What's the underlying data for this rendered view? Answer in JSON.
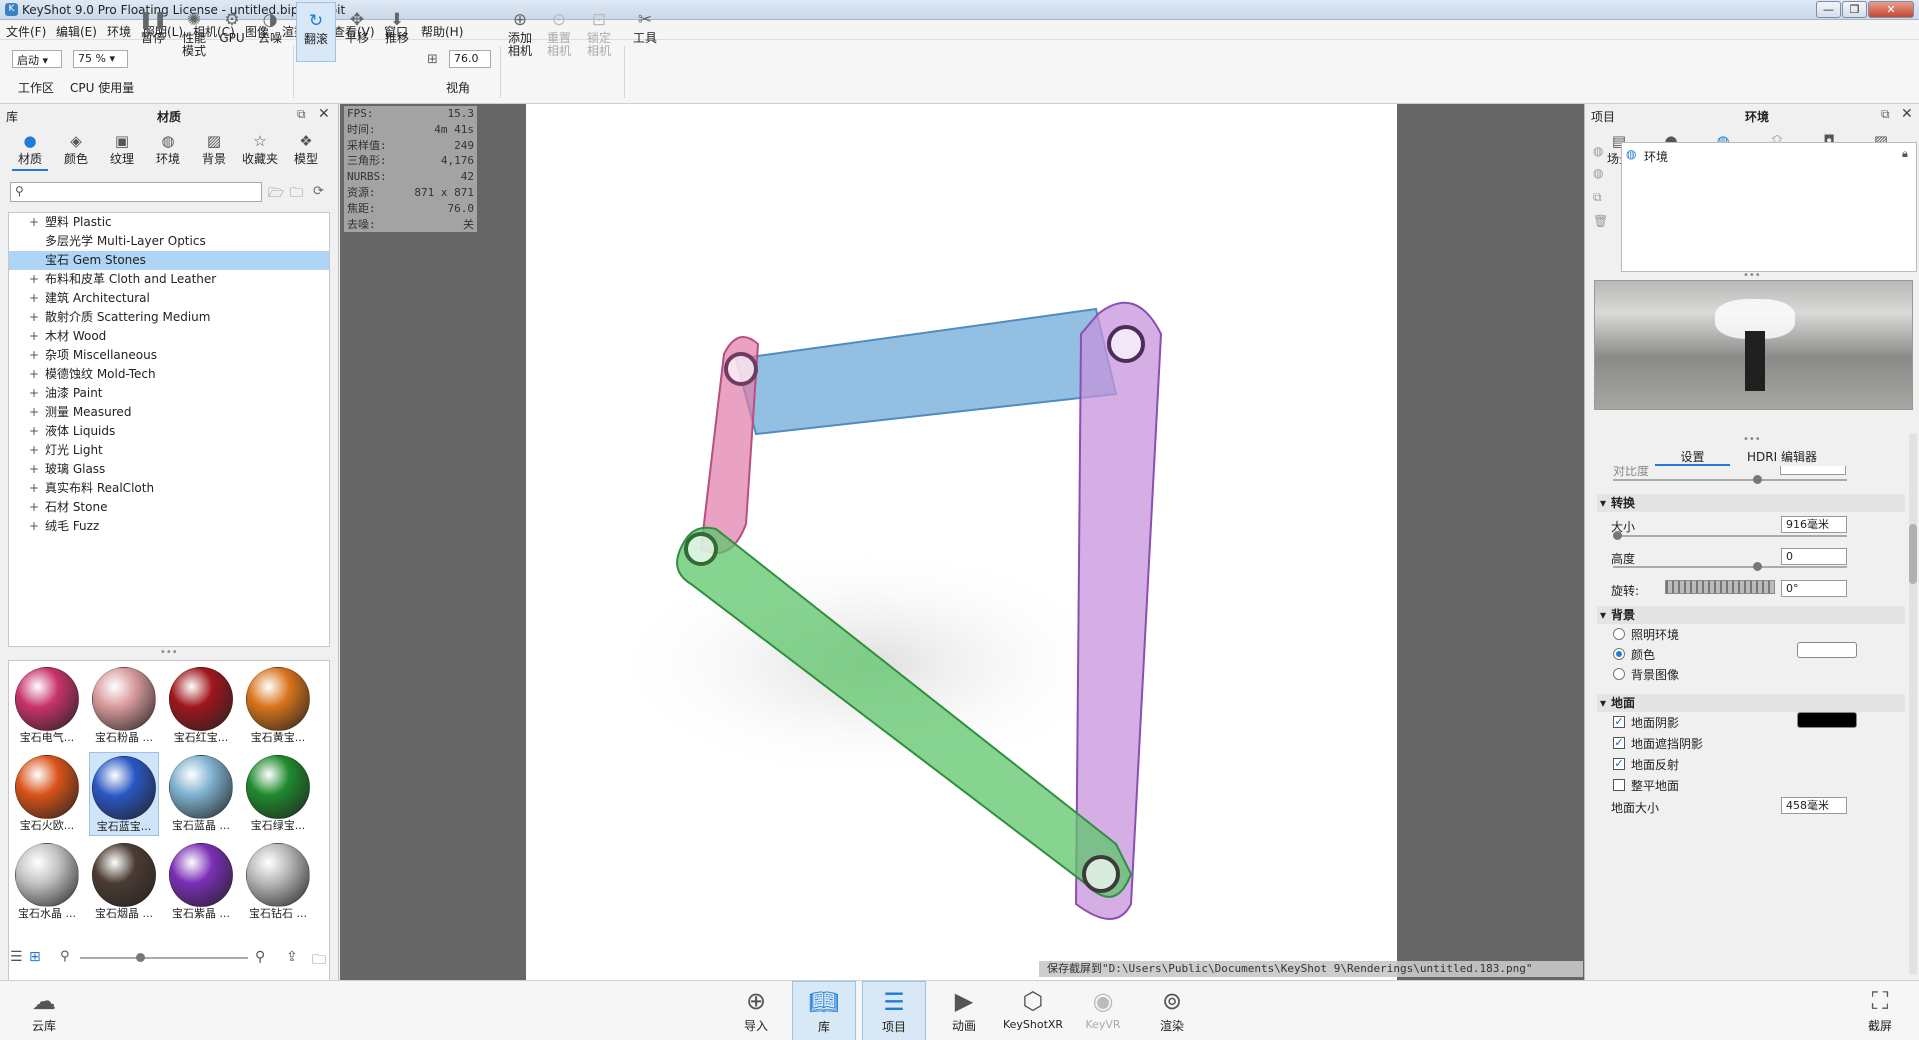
{
  "window": {
    "title": "KeyShot 9.0 Pro Floating License  - untitled.bip  - 64 bit",
    "icon": "keyshot-app-icon"
  },
  "menu": [
    "文件(F)",
    "编辑(E)",
    "环境",
    "照明(L)",
    "相机(C)",
    "图像",
    "渲染(R)",
    "查看(V)",
    "窗口",
    "帮助(H)"
  ],
  "toolbar": {
    "workspace_value": "启动",
    "workspace_label": "工作区",
    "cpu_value": "75 %",
    "cpu_label": "CPU 使用量",
    "pause_label": "暂停",
    "perf_label": "性能\n模式",
    "gpu_label": "GPU",
    "denoise_label": "去噪",
    "tumble_label": "翻滚",
    "pan_label": "平移",
    "dolly_label": "推移",
    "fov_value": "76.0",
    "fov_label": "视角",
    "add_camera_label": "添加\n相机",
    "reset_camera_label": "重置\n相机",
    "lock_camera_label": "锁定\n相机",
    "tools_label": "工具"
  },
  "library": {
    "header_left": "库",
    "title": "材质",
    "tabs": [
      "材质",
      "颜色",
      "纹理",
      "环境",
      "背景",
      "收藏夹",
      "模型"
    ],
    "tree": [
      {
        "label": "塑料 Plastic",
        "expand": true,
        "selected": false
      },
      {
        "label": "多层光学 Multi-Layer Optics",
        "expand": false,
        "selected": false
      },
      {
        "label": "宝石 Gem Stones",
        "expand": false,
        "selected": true
      },
      {
        "label": "布料和皮革 Cloth and Leather",
        "expand": true,
        "selected": false
      },
      {
        "label": "建筑 Architectural",
        "expand": true,
        "selected": false
      },
      {
        "label": "散射介质 Scattering Medium",
        "expand": true,
        "selected": false
      },
      {
        "label": "木材 Wood",
        "expand": true,
        "selected": false
      },
      {
        "label": "杂项 Miscellaneous",
        "expand": true,
        "selected": false
      },
      {
        "label": "模德蚀纹 Mold-Tech",
        "expand": true,
        "selected": false
      },
      {
        "label": "油漆 Paint",
        "expand": true,
        "selected": false
      },
      {
        "label": "测量 Measured",
        "expand": true,
        "selected": false
      },
      {
        "label": "液体 Liquids",
        "expand": true,
        "selected": false
      },
      {
        "label": "灯光 Light",
        "expand": true,
        "selected": false
      },
      {
        "label": "玻璃 Glass",
        "expand": true,
        "selected": false
      },
      {
        "label": "真实布料 RealCloth",
        "expand": true,
        "selected": false
      },
      {
        "label": "石材 Stone",
        "expand": true,
        "selected": false
      },
      {
        "label": "绒毛 Fuzz",
        "expand": true,
        "selected": false
      }
    ],
    "materials": [
      {
        "label": "宝石电气...",
        "color": "#c8336b",
        "selected": false
      },
      {
        "label": "宝石粉晶 ...",
        "color": "#d89a9c",
        "selected": false
      },
      {
        "label": "宝石红宝...",
        "color": "#a0161c",
        "selected": false
      },
      {
        "label": "宝石黄宝...",
        "color": "#d9741c",
        "selected": false
      },
      {
        "label": "宝石火欧...",
        "color": "#d9531a",
        "selected": false
      },
      {
        "label": "宝石蓝宝...",
        "color": "#2a57c4",
        "selected": true
      },
      {
        "label": "宝石蓝晶 ...",
        "color": "#7fb1cf",
        "selected": false
      },
      {
        "label": "宝石绿宝...",
        "color": "#1f8a2e",
        "selected": false
      },
      {
        "label": "宝石水晶 ...",
        "color": "#c4c4c4",
        "selected": false
      },
      {
        "label": "宝石烟晶 ...",
        "color": "#4b3c33",
        "selected": false
      },
      {
        "label": "宝石紫晶 ...",
        "color": "#7a2fb6",
        "selected": false
      },
      {
        "label": "宝石钻石 ...",
        "color": "#b8b8b8",
        "selected": false
      }
    ]
  },
  "stats": [
    {
      "k": "FPS:",
      "v": "15.3"
    },
    {
      "k": "时间:",
      "v": "4m 41s"
    },
    {
      "k": "采样值:",
      "v": "249"
    },
    {
      "k": "三角形:",
      "v": "4,176"
    },
    {
      "k": "NURBS:",
      "v": "42"
    },
    {
      "k": "资源:",
      "v": "871 x 871"
    },
    {
      "k": "焦距:",
      "v": "76.0"
    },
    {
      "k": "去噪:",
      "v": "关"
    }
  ],
  "saveline": "保存截屏到\"D:\\Users\\Public\\Documents\\KeyShot 9\\Renderings\\untitled.183.png\"",
  "project": {
    "header_left": "项目",
    "title": "环境",
    "tabs": [
      "场景",
      "材质",
      "环境",
      "照明",
      "相机",
      "图像"
    ],
    "env_item": "环境",
    "subtabs": [
      "设置",
      "HDRI 编辑器"
    ],
    "contrast_label": "对比度",
    "transform": {
      "title": "转换",
      "size_label": "大小",
      "size_value": "916毫米",
      "height_label": "高度",
      "height_value": "0",
      "rotate_label": "旋转:",
      "rotate_value": "0°"
    },
    "background": {
      "title": "背景",
      "options": [
        "照明环境",
        "颜色",
        "背景图像"
      ],
      "selected": 1
    },
    "ground": {
      "title": "地面",
      "checks": [
        {
          "label": "地面阴影",
          "on": true
        },
        {
          "label": "地面遮挡阴影",
          "on": true
        },
        {
          "label": "地面反射",
          "on": true
        },
        {
          "label": "整平地面",
          "on": false
        }
      ],
      "size_label": "地面大小",
      "size_value": "458毫米",
      "shadow_color": "#000000"
    }
  },
  "bottombar": {
    "cloud_label": "云库",
    "import_label": "导入",
    "library_label": "库",
    "project_label": "项目",
    "animation_label": "动画",
    "keyshotxr_label": "KeyShotXR",
    "keyvr_label": "KeyVR",
    "render_label": "渲染",
    "screenshot_label": "截屏"
  },
  "colors": {
    "accent": "#1e7bd6",
    "selection": "#aed4f6",
    "viewport_bg": "#666666"
  }
}
